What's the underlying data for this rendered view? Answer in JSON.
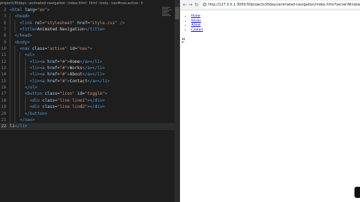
{
  "breadcrumb": [
    "projects30days",
    "animated-navigation",
    "index.html",
    "html",
    "body",
    "nav#nav.active",
    "li"
  ],
  "breadcrumb_icons": [
    "folder-icon",
    "folder-icon",
    "html-file-icon",
    "tag-icon",
    "tag-icon",
    "tag-icon",
    "tag-icon"
  ],
  "editor": {
    "lines": [
      {
        "n": "2",
        "indent": 0,
        "tokens": [
          {
            "c": "tk-tag",
            "t": "<html "
          },
          {
            "c": "tk-attr",
            "t": "lang"
          },
          {
            "c": "tk-txt",
            "t": "="
          },
          {
            "c": "tk-str",
            "t": "\"en\""
          },
          {
            "c": "tk-tag",
            "t": ">"
          }
        ]
      },
      {
        "n": "3",
        "indent": 1,
        "tokens": [
          {
            "c": "tk-tag",
            "t": "<head>"
          }
        ]
      },
      {
        "n": "6",
        "indent": 2,
        "tokens": [
          {
            "c": "tk-tag",
            "t": "<link "
          },
          {
            "c": "tk-attr",
            "t": "rel"
          },
          {
            "c": "tk-txt",
            "t": "="
          },
          {
            "c": "tk-str",
            "t": "\"stylesheet\""
          },
          {
            "c": "tk-txt",
            "t": " "
          },
          {
            "c": "tk-attr",
            "t": "href"
          },
          {
            "c": "tk-txt",
            "t": "="
          },
          {
            "c": "tk-str",
            "t": "\"style.css\""
          },
          {
            "c": "tk-tag",
            "t": " />"
          }
        ]
      },
      {
        "n": "7",
        "indent": 2,
        "tokens": [
          {
            "c": "tk-tag",
            "t": "<title>"
          },
          {
            "c": "tk-txt",
            "t": "Animated Navigation"
          },
          {
            "c": "tk-tag",
            "t": "</title>"
          }
        ]
      },
      {
        "n": "8",
        "indent": 1,
        "tokens": [
          {
            "c": "tk-tag",
            "t": "</head>"
          }
        ]
      },
      {
        "n": "9",
        "indent": 1,
        "tokens": [
          {
            "c": "tk-tag",
            "t": "<body>"
          }
        ]
      },
      {
        "n": "10",
        "indent": 2,
        "tokens": [
          {
            "c": "tk-tag",
            "t": "<nav "
          },
          {
            "c": "tk-attr",
            "t": "class"
          },
          {
            "c": "tk-txt",
            "t": "="
          },
          {
            "c": "tk-str",
            "t": "\"active\""
          },
          {
            "c": "tk-txt",
            "t": " "
          },
          {
            "c": "tk-attr",
            "t": "id"
          },
          {
            "c": "tk-txt",
            "t": "="
          },
          {
            "c": "tk-str",
            "t": "\"nav\""
          },
          {
            "c": "tk-tag",
            "t": ">"
          }
        ]
      },
      {
        "n": "11",
        "indent": 3,
        "tokens": [
          {
            "c": "tk-tag",
            "t": "<ul>"
          }
        ]
      },
      {
        "n": "12",
        "indent": 4,
        "tokens": [
          {
            "c": "tk-tag",
            "t": "<li><a "
          },
          {
            "c": "tk-attr",
            "t": "href"
          },
          {
            "c": "tk-txt",
            "t": "="
          },
          {
            "c": "tk-str",
            "t": "\"#\""
          },
          {
            "c": "tk-tag",
            "t": ">"
          },
          {
            "c": "tk-txt",
            "t": "Home"
          },
          {
            "c": "tk-tag",
            "t": "</a></li>"
          }
        ]
      },
      {
        "n": "13",
        "indent": 4,
        "tokens": [
          {
            "c": "tk-tag",
            "t": "<li><a "
          },
          {
            "c": "tk-attr",
            "t": "href"
          },
          {
            "c": "tk-txt",
            "t": "="
          },
          {
            "c": "tk-str",
            "t": "\"#\""
          },
          {
            "c": "tk-tag",
            "t": ">"
          },
          {
            "c": "tk-txt",
            "t": "Works"
          },
          {
            "c": "tk-tag",
            "t": "</a></li>"
          }
        ]
      },
      {
        "n": "14",
        "indent": 4,
        "tokens": [
          {
            "c": "tk-tag",
            "t": "<li><a "
          },
          {
            "c": "tk-attr",
            "t": "href"
          },
          {
            "c": "tk-txt",
            "t": "="
          },
          {
            "c": "tk-str",
            "t": "\"#\""
          },
          {
            "c": "tk-tag",
            "t": ">"
          },
          {
            "c": "tk-txt",
            "t": "About"
          },
          {
            "c": "tk-tag",
            "t": "</a></li>"
          }
        ]
      },
      {
        "n": "15",
        "indent": 4,
        "tokens": [
          {
            "c": "tk-tag",
            "t": "<li><a "
          },
          {
            "c": "tk-attr",
            "t": "href"
          },
          {
            "c": "tk-txt",
            "t": "="
          },
          {
            "c": "tk-str",
            "t": "\"#\""
          },
          {
            "c": "tk-tag",
            "t": ">"
          },
          {
            "c": "tk-txt",
            "t": "Contact"
          },
          {
            "c": "tk-tag",
            "t": "</a></li>"
          }
        ]
      },
      {
        "n": "16",
        "indent": 3,
        "tokens": [
          {
            "c": "tk-tag",
            "t": "</ul>"
          }
        ]
      },
      {
        "n": "17",
        "indent": 3,
        "tokens": [
          {
            "c": "tk-tag",
            "t": "<button "
          },
          {
            "c": "tk-attr",
            "t": "class"
          },
          {
            "c": "tk-txt",
            "t": "="
          },
          {
            "c": "tk-str",
            "t": "\"icon\""
          },
          {
            "c": "tk-txt",
            "t": " "
          },
          {
            "c": "tk-attr",
            "t": "id"
          },
          {
            "c": "tk-txt",
            "t": "="
          },
          {
            "c": "tk-str",
            "t": "\"toggle\""
          },
          {
            "c": "tk-tag",
            "t": ">"
          }
        ]
      },
      {
        "n": "18",
        "indent": 4,
        "tokens": [
          {
            "c": "tk-tag",
            "t": "<div "
          },
          {
            "c": "tk-attr",
            "t": "class"
          },
          {
            "c": "tk-txt",
            "t": "="
          },
          {
            "c": "tk-str",
            "t": "\"line line1\""
          },
          {
            "c": "tk-tag",
            "t": "></div>"
          }
        ]
      },
      {
        "n": "19",
        "indent": 4,
        "tokens": [
          {
            "c": "tk-tag",
            "t": "<div "
          },
          {
            "c": "tk-attr",
            "t": "class"
          },
          {
            "c": "tk-txt",
            "t": "="
          },
          {
            "c": "tk-str",
            "t": "\"line line2\""
          },
          {
            "c": "tk-tag",
            "t": "></div>"
          }
        ]
      },
      {
        "n": "20",
        "indent": 3,
        "tokens": [
          {
            "c": "tk-tag",
            "t": "</button>"
          }
        ]
      },
      {
        "n": "21",
        "indent": 2,
        "tokens": [
          {
            "c": "tk-tag",
            "t": "</nav>"
          }
        ]
      },
      {
        "n": "22",
        "indent": 0,
        "current": true,
        "tokens": [
          {
            "c": "tk-txt",
            "t": "li"
          },
          {
            "c": "tk-tag",
            "t": "</li>"
          }
        ]
      }
    ]
  },
  "browser": {
    "url": "http://127.0.0.1:3000/30projects30days/animated-navigation/index.html?serverWindowId=51e5f7c2-54c7-4a",
    "nav_icons": [
      "back-arrow-icon",
      "forward-arrow-icon",
      "reload-icon"
    ],
    "nav_glyphs": [
      "←",
      "→",
      "↻"
    ],
    "links": [
      "Home",
      "Works",
      "About",
      "Contact"
    ],
    "toggle_lines": "a="
  }
}
